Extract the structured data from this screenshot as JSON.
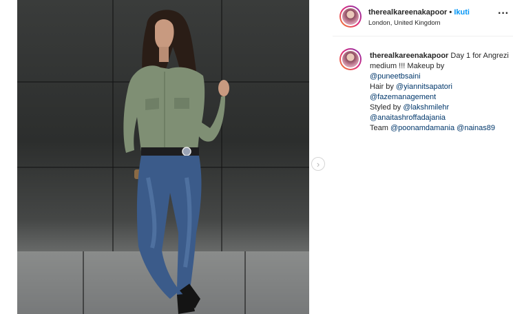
{
  "post": {
    "username": "therealkareenakapoor",
    "dot": "•",
    "follow_label": "Ikuti",
    "location": "London, United Kingdom",
    "more_label": "···",
    "nav_next": "›"
  },
  "caption": {
    "username": "therealkareenakapoor",
    "text_1": " Day 1 for Angrezi medium !!! Makeup by",
    "mention_makeup": "@puneetbsaini",
    "hair_prefix": "Hair by ",
    "mention_hair": "@yiannitsapatori",
    "mention_mgmt": "@fazemanagement",
    "styled_prefix": "Styled by ",
    "mention_styled": "@lakshmilehr",
    "mention_styled2": "@anaitashroffadajania",
    "team_prefix": "Team ",
    "mention_team1": "@poonamdamania",
    "mention_team2": "@nainas89"
  },
  "colors": {
    "accent_link": "#0095f6",
    "mention": "#00376b",
    "text": "#262626"
  },
  "icons": [
    "more-options-icon",
    "next-arrow-icon",
    "avatar"
  ]
}
